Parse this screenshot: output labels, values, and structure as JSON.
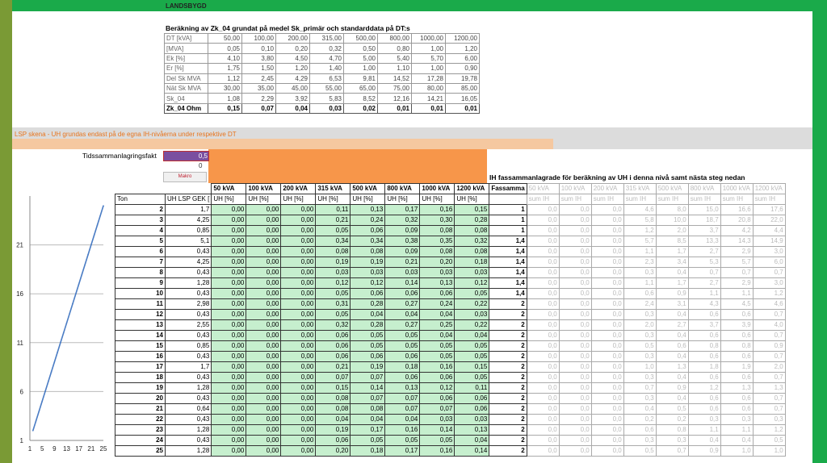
{
  "app": {
    "title": "LANDSBYGD"
  },
  "reference": {
    "title": "Beräkning av Zk_04 grundat på medel Sk_primär och standarddata på DT:s",
    "rows": [
      {
        "label": "DT [kVA]",
        "values": [
          "50,00",
          "100,00",
          "200,00",
          "315,00",
          "500,00",
          "800,00",
          "1000,00",
          "1200,00"
        ]
      },
      {
        "label": "[MVA]",
        "values": [
          "0,05",
          "0,10",
          "0,20",
          "0,32",
          "0,50",
          "0,80",
          "1,00",
          "1,20"
        ]
      },
      {
        "label": "Ek [%]",
        "values": [
          "4,10",
          "3,80",
          "4,50",
          "4,70",
          "5,00",
          "5,40",
          "5,70",
          "6,00"
        ]
      },
      {
        "label": "Er [%]",
        "values": [
          "1,75",
          "1,50",
          "1,20",
          "1,40",
          "1,00",
          "1,10",
          "1,00",
          "0,90"
        ]
      },
      {
        "label": "Del Sk MVA",
        "values": [
          "1,12",
          "2,45",
          "4,29",
          "6,53",
          "9,81",
          "14,52",
          "17,28",
          "19,78"
        ]
      },
      {
        "label": "Nät Sk MVA",
        "values": [
          "30,00",
          "35,00",
          "45,00",
          "55,00",
          "65,00",
          "75,00",
          "80,00",
          "85,00"
        ]
      },
      {
        "label": "Sk_04",
        "values": [
          "1,08",
          "2,29",
          "3,92",
          "5,83",
          "8,52",
          "12,16",
          "14,21",
          "16,05"
        ]
      },
      {
        "label": "Zk_04 Ohm",
        "values": [
          "0,15",
          "0,07",
          "0,04",
          "0,03",
          "0,02",
          "0,01",
          "0,01",
          "0,01"
        ]
      }
    ]
  },
  "lsp": {
    "label": "LSP skena - UH grundas endast på de egna IH-nivåerna under respektive DT"
  },
  "controls": {
    "tids_label": "Tidssammanlagringsfakt",
    "tids_value": "0,5",
    "zero_value": "0",
    "makro_label": "Makro"
  },
  "ih_header": "IH fassammanlagrade för beräkning av UH i denna nivå samt nästa steg nedan",
  "main": {
    "kva_headers": [
      "50 kVA",
      "100 kVA",
      "200 kVA",
      "315 kVA",
      "500 kVA",
      "800 kVA",
      "1000 kVA",
      "1200 kVA"
    ],
    "ton_header": "Ton",
    "gek_header": "UH LSP GEK [",
    "uh_subheader": "UH [%]",
    "fas_header": "Fassamma",
    "ih_headers": [
      "50 kVA",
      "100 kVA",
      "200 kVA",
      "315 kVA",
      "500 kVA",
      "800 kVA",
      "1000 kVA",
      "1200 kVA"
    ],
    "ih_subheader": "sum IH",
    "rows": [
      {
        "ton": "2",
        "gek": "1,7",
        "uh": [
          "0,00",
          "0,00",
          "0,00",
          "0,11",
          "0,13",
          "0,17",
          "0,16",
          "0,15"
        ],
        "fas": "1",
        "ih": [
          "0,0",
          "0,0",
          "0,0",
          "4,6",
          "8,0",
          "15,0",
          "16,6",
          "17,6"
        ]
      },
      {
        "ton": "3",
        "gek": "4,25",
        "uh": [
          "0,00",
          "0,00",
          "0,00",
          "0,21",
          "0,24",
          "0,32",
          "0,30",
          "0,28"
        ],
        "fas": "1",
        "ih": [
          "0,0",
          "0,0",
          "0,0",
          "5,8",
          "10,0",
          "18,7",
          "20,8",
          "22,0"
        ]
      },
      {
        "ton": "4",
        "gek": "0,85",
        "uh": [
          "0,00",
          "0,00",
          "0,00",
          "0,05",
          "0,06",
          "0,09",
          "0,08",
          "0,08"
        ],
        "fas": "1",
        "ih": [
          "0,0",
          "0,0",
          "0,0",
          "1,2",
          "2,0",
          "3,7",
          "4,2",
          "4,4"
        ]
      },
      {
        "ton": "5",
        "gek": "5,1",
        "uh": [
          "0,00",
          "0,00",
          "0,00",
          "0,34",
          "0,34",
          "0,38",
          "0,35",
          "0,32"
        ],
        "fas": "1,4",
        "ih": [
          "0,0",
          "0,0",
          "0,0",
          "5,7",
          "8,5",
          "13,3",
          "14,3",
          "14,9"
        ]
      },
      {
        "ton": "6",
        "gek": "0,43",
        "uh": [
          "0,00",
          "0,00",
          "0,00",
          "0,08",
          "0,08",
          "0,09",
          "0,08",
          "0,08"
        ],
        "fas": "1,4",
        "ih": [
          "0,0",
          "0,0",
          "0,0",
          "1,1",
          "1,7",
          "2,7",
          "2,9",
          "3,0"
        ]
      },
      {
        "ton": "7",
        "gek": "4,25",
        "uh": [
          "0,00",
          "0,00",
          "0,00",
          "0,19",
          "0,19",
          "0,21",
          "0,20",
          "0,18"
        ],
        "fas": "1,4",
        "ih": [
          "0,0",
          "0,0",
          "0,0",
          "2,3",
          "3,4",
          "5,3",
          "5,7",
          "6,0"
        ]
      },
      {
        "ton": "8",
        "gek": "0,43",
        "uh": [
          "0,00",
          "0,00",
          "0,00",
          "0,03",
          "0,03",
          "0,03",
          "0,03",
          "0,03"
        ],
        "fas": "1,4",
        "ih": [
          "0,0",
          "0,0",
          "0,0",
          "0,3",
          "0,4",
          "0,7",
          "0,7",
          "0,7"
        ]
      },
      {
        "ton": "9",
        "gek": "1,28",
        "uh": [
          "0,00",
          "0,00",
          "0,00",
          "0,12",
          "0,12",
          "0,14",
          "0,13",
          "0,12"
        ],
        "fas": "1,4",
        "ih": [
          "0,0",
          "0,0",
          "0,0",
          "1,1",
          "1,7",
          "2,7",
          "2,9",
          "3,0"
        ]
      },
      {
        "ton": "10",
        "gek": "0,43",
        "uh": [
          "0,00",
          "0,00",
          "0,00",
          "0,05",
          "0,06",
          "0,06",
          "0,06",
          "0,05"
        ],
        "fas": "1,4",
        "ih": [
          "0,0",
          "0,0",
          "0,0",
          "0,6",
          "0,9",
          "1,1",
          "1,1",
          "1,2"
        ]
      },
      {
        "ton": "11",
        "gek": "2,98",
        "uh": [
          "0,00",
          "0,00",
          "0,00",
          "0,31",
          "0,28",
          "0,27",
          "0,24",
          "0,22"
        ],
        "fas": "2",
        "ih": [
          "0,0",
          "0,0",
          "0,0",
          "2,4",
          "3,1",
          "4,3",
          "4,5",
          "4,6"
        ]
      },
      {
        "ton": "12",
        "gek": "0,43",
        "uh": [
          "0,00",
          "0,00",
          "0,00",
          "0,05",
          "0,04",
          "0,04",
          "0,04",
          "0,03"
        ],
        "fas": "2",
        "ih": [
          "0,0",
          "0,0",
          "0,0",
          "0,3",
          "0,4",
          "0,6",
          "0,6",
          "0,7"
        ]
      },
      {
        "ton": "13",
        "gek": "2,55",
        "uh": [
          "0,00",
          "0,00",
          "0,00",
          "0,32",
          "0,28",
          "0,27",
          "0,25",
          "0,22"
        ],
        "fas": "2",
        "ih": [
          "0,0",
          "0,0",
          "0,0",
          "2,0",
          "2,7",
          "3,7",
          "3,9",
          "4,0"
        ]
      },
      {
        "ton": "14",
        "gek": "0,43",
        "uh": [
          "0,00",
          "0,00",
          "0,00",
          "0,06",
          "0,05",
          "0,05",
          "0,04",
          "0,04"
        ],
        "fas": "2",
        "ih": [
          "0,0",
          "0,0",
          "0,0",
          "0,3",
          "0,4",
          "0,6",
          "0,6",
          "0,7"
        ]
      },
      {
        "ton": "15",
        "gek": "0,85",
        "uh": [
          "0,00",
          "0,00",
          "0,00",
          "0,06",
          "0,05",
          "0,05",
          "0,05",
          "0,05"
        ],
        "fas": "2",
        "ih": [
          "0,0",
          "0,0",
          "0,0",
          "0,5",
          "0,6",
          "0,8",
          "0,8",
          "0,9"
        ]
      },
      {
        "ton": "16",
        "gek": "0,43",
        "uh": [
          "0,00",
          "0,00",
          "0,00",
          "0,06",
          "0,06",
          "0,06",
          "0,05",
          "0,05"
        ],
        "fas": "2",
        "ih": [
          "0,0",
          "0,0",
          "0,0",
          "0,3",
          "0,4",
          "0,6",
          "0,6",
          "0,7"
        ]
      },
      {
        "ton": "17",
        "gek": "1,7",
        "uh": [
          "0,00",
          "0,00",
          "0,00",
          "0,21",
          "0,19",
          "0,18",
          "0,16",
          "0,15"
        ],
        "fas": "2",
        "ih": [
          "0,0",
          "0,0",
          "0,0",
          "1,0",
          "1,3",
          "1,8",
          "1,9",
          "2,0"
        ]
      },
      {
        "ton": "18",
        "gek": "0,43",
        "uh": [
          "0,00",
          "0,00",
          "0,00",
          "0,07",
          "0,07",
          "0,06",
          "0,06",
          "0,05"
        ],
        "fas": "2",
        "ih": [
          "0,0",
          "0,0",
          "0,0",
          "0,3",
          "0,4",
          "0,6",
          "0,6",
          "0,7"
        ]
      },
      {
        "ton": "19",
        "gek": "1,28",
        "uh": [
          "0,00",
          "0,00",
          "0,00",
          "0,15",
          "0,14",
          "0,13",
          "0,12",
          "0,11"
        ],
        "fas": "2",
        "ih": [
          "0,0",
          "0,0",
          "0,0",
          "0,7",
          "0,9",
          "1,2",
          "1,3",
          "1,3"
        ]
      },
      {
        "ton": "20",
        "gek": "0,43",
        "uh": [
          "0,00",
          "0,00",
          "0,00",
          "0,08",
          "0,07",
          "0,07",
          "0,06",
          "0,06"
        ],
        "fas": "2",
        "ih": [
          "0,0",
          "0,0",
          "0,0",
          "0,3",
          "0,4",
          "0,6",
          "0,6",
          "0,7"
        ]
      },
      {
        "ton": "21",
        "gek": "0,64",
        "uh": [
          "0,00",
          "0,00",
          "0,00",
          "0,08",
          "0,08",
          "0,07",
          "0,07",
          "0,06"
        ],
        "fas": "2",
        "ih": [
          "0,0",
          "0,0",
          "0,0",
          "0,4",
          "0,5",
          "0,6",
          "0,6",
          "0,7"
        ]
      },
      {
        "ton": "22",
        "gek": "0,43",
        "uh": [
          "0,00",
          "0,00",
          "0,00",
          "0,04",
          "0,04",
          "0,04",
          "0,03",
          "0,03"
        ],
        "fas": "2",
        "ih": [
          "0,0",
          "0,0",
          "0,0",
          "0,2",
          "0,2",
          "0,3",
          "0,3",
          "0,3"
        ]
      },
      {
        "ton": "23",
        "gek": "1,28",
        "uh": [
          "0,00",
          "0,00",
          "0,00",
          "0,19",
          "0,17",
          "0,16",
          "0,14",
          "0,13"
        ],
        "fas": "2",
        "ih": [
          "0,0",
          "0,0",
          "0,0",
          "0,6",
          "0,8",
          "1,1",
          "1,1",
          "1,2"
        ]
      },
      {
        "ton": "24",
        "gek": "0,43",
        "uh": [
          "0,00",
          "0,00",
          "0,00",
          "0,06",
          "0,05",
          "0,05",
          "0,05",
          "0,04"
        ],
        "fas": "2",
        "ih": [
          "0,0",
          "0,0",
          "0,0",
          "0,3",
          "0,3",
          "0,4",
          "0,4",
          "0,5"
        ]
      },
      {
        "ton": "25",
        "gek": "1,28",
        "uh": [
          "0,00",
          "0,00",
          "0,00",
          "0,20",
          "0,18",
          "0,17",
          "0,16",
          "0,14"
        ],
        "fas": "2",
        "ih": [
          "0,0",
          "0,0",
          "0,0",
          "0,5",
          "0,7",
          "0,9",
          "1,0",
          "1,0"
        ]
      }
    ]
  },
  "chart_data": {
    "type": "line",
    "x": [
      2,
      3,
      4,
      5,
      6,
      7,
      8,
      9,
      10,
      11,
      12,
      13,
      14,
      15,
      16,
      17,
      18,
      19,
      20,
      21,
      22,
      23,
      24,
      25
    ],
    "series": [
      {
        "values": [
          2,
          3,
          4,
          5,
          6,
          7,
          8,
          9,
          10,
          11,
          12,
          13,
          14,
          15,
          16,
          17,
          18,
          19,
          20,
          21,
          22,
          23,
          24,
          25
        ]
      }
    ],
    "xticks": [
      "1",
      "5",
      "9",
      "13",
      "17",
      "21",
      "25"
    ],
    "yticks": [
      "1",
      "6",
      "11",
      "16",
      "21"
    ],
    "xlim": [
      1,
      25
    ],
    "ylim": [
      1,
      26
    ],
    "grid": true,
    "line_color": "#4a7cc4"
  }
}
